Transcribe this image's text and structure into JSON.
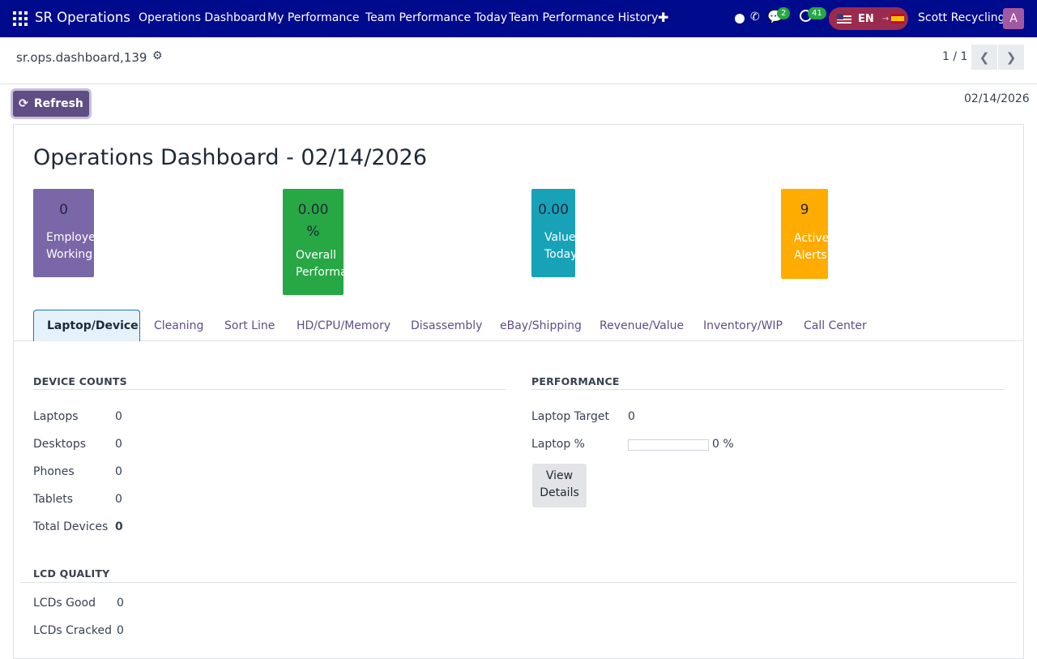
{
  "nav": {
    "brand": "SR Operations",
    "menus": [
      "Operations Dashboard",
      "My Performance",
      "Team Performance Today",
      "Team Performance History"
    ],
    "chat_badge": "2",
    "activity_badge": "41",
    "lang_code": "EN",
    "user": "Scott Recycling",
    "avatar_letter": "A"
  },
  "control": {
    "record_name": "sr.ops.dashboard,139",
    "pager": "1 / 1"
  },
  "toolbar": {
    "refresh_label": "Refresh",
    "date": "02/14/2026"
  },
  "sheet": {
    "title": "Operations Dashboard - 02/14/2026",
    "kpis": [
      {
        "value": "0",
        "label_lines": [
          "Employees",
          "Working"
        ],
        "color": "#7a67a7"
      },
      {
        "value": "0.00",
        "value2": "%",
        "label_lines": [
          "Overall",
          "Performance"
        ],
        "color": "#28a745"
      },
      {
        "value": "0.00",
        "label_lines": [
          "Value",
          "Today"
        ],
        "color": "#17a2b8"
      },
      {
        "value": "9",
        "label_lines": [
          "Active",
          "Alerts"
        ],
        "color": "#ffac00"
      }
    ],
    "tabs": [
      "Laptop/Device",
      "Cleaning",
      "Sort Line",
      "HD/CPU/Memory",
      "Disassembly",
      "eBay/Shipping",
      "Revenue/Value",
      "Inventory/WIP",
      "Call Center"
    ],
    "device_counts": {
      "heading": "DEVICE COUNTS",
      "rows": [
        {
          "label": "Laptops",
          "value": "0"
        },
        {
          "label": "Desktops",
          "value": "0"
        },
        {
          "label": "Phones",
          "value": "0"
        },
        {
          "label": "Tablets",
          "value": "0"
        },
        {
          "label": "Total Devices",
          "value": "0"
        }
      ]
    },
    "performance": {
      "heading": "PERFORMANCE",
      "target_label": "Laptop Target",
      "target_value": "0",
      "pct_label": "Laptop %",
      "pct_value": "0 %",
      "view_details": [
        "View",
        "Details"
      ]
    },
    "lcd_quality": {
      "heading": "LCD QUALITY",
      "rows": [
        {
          "label": "LCDs Good",
          "value": "0"
        },
        {
          "label": "LCDs Cracked",
          "value": "0"
        }
      ]
    }
  }
}
